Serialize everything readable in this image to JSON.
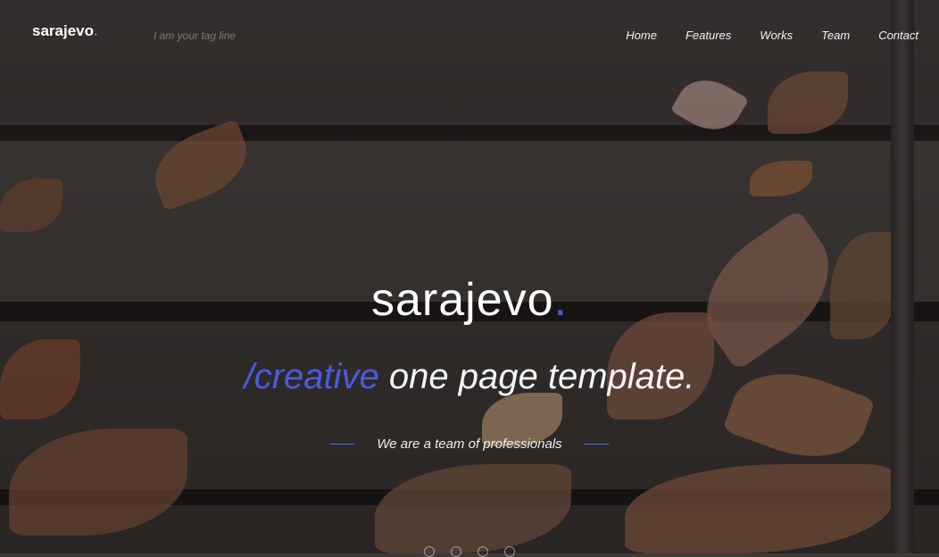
{
  "brand": {
    "name": "sarajevo",
    "dot": "."
  },
  "tagline": "I am your tag line",
  "nav": {
    "items": [
      {
        "label": "Home"
      },
      {
        "label": "Features"
      },
      {
        "label": "Works"
      },
      {
        "label": "Team"
      },
      {
        "label": "Contact"
      }
    ]
  },
  "hero": {
    "title": "sarajevo",
    "title_dot": ".",
    "subtitle_accent": "/creative",
    "subtitle_rest": " one page template.",
    "tagline": "We are a team of professionals"
  },
  "colors": {
    "accent": "#4a5be0",
    "text": "#ffffff"
  }
}
